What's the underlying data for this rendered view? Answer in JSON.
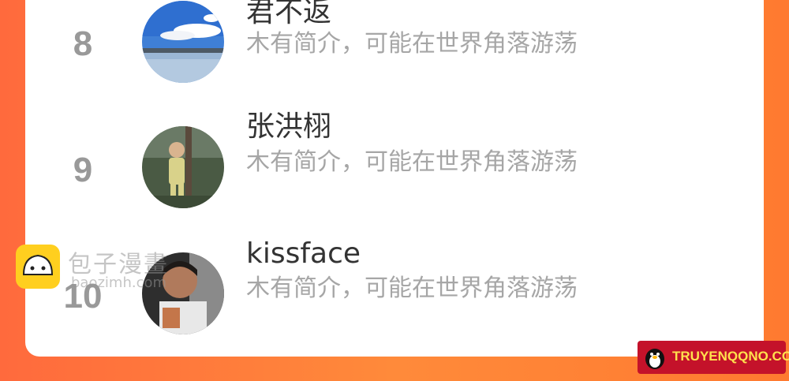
{
  "ranking": [
    {
      "rank": "8",
      "name": "君不返",
      "intro": "木有简介，可能在世界角落游荡",
      "avatar_icon": "lake-sky-avatar"
    },
    {
      "rank": "9",
      "name": "张洪栩",
      "intro": "木有简介，可能在世界角落游荡",
      "avatar_icon": "child-photo-avatar"
    },
    {
      "rank": "10",
      "name": "kissface",
      "intro": "木有简介，可能在世界角落游荡",
      "avatar_icon": "man-photo-avatar"
    }
  ],
  "watermark_baozi": {
    "title": "包子漫畫",
    "domain": "baozimh.com",
    "logo_icon": "baozi-bun-icon"
  },
  "watermark_truyen": {
    "text": "TRUYENQQNO.COM",
    "logo_icon": "penguin-icon"
  },
  "colors": {
    "background": "#ff7a35",
    "card": "#ffffff",
    "rank": "#999999",
    "name": "#333333",
    "intro": "#a6a6a6"
  }
}
